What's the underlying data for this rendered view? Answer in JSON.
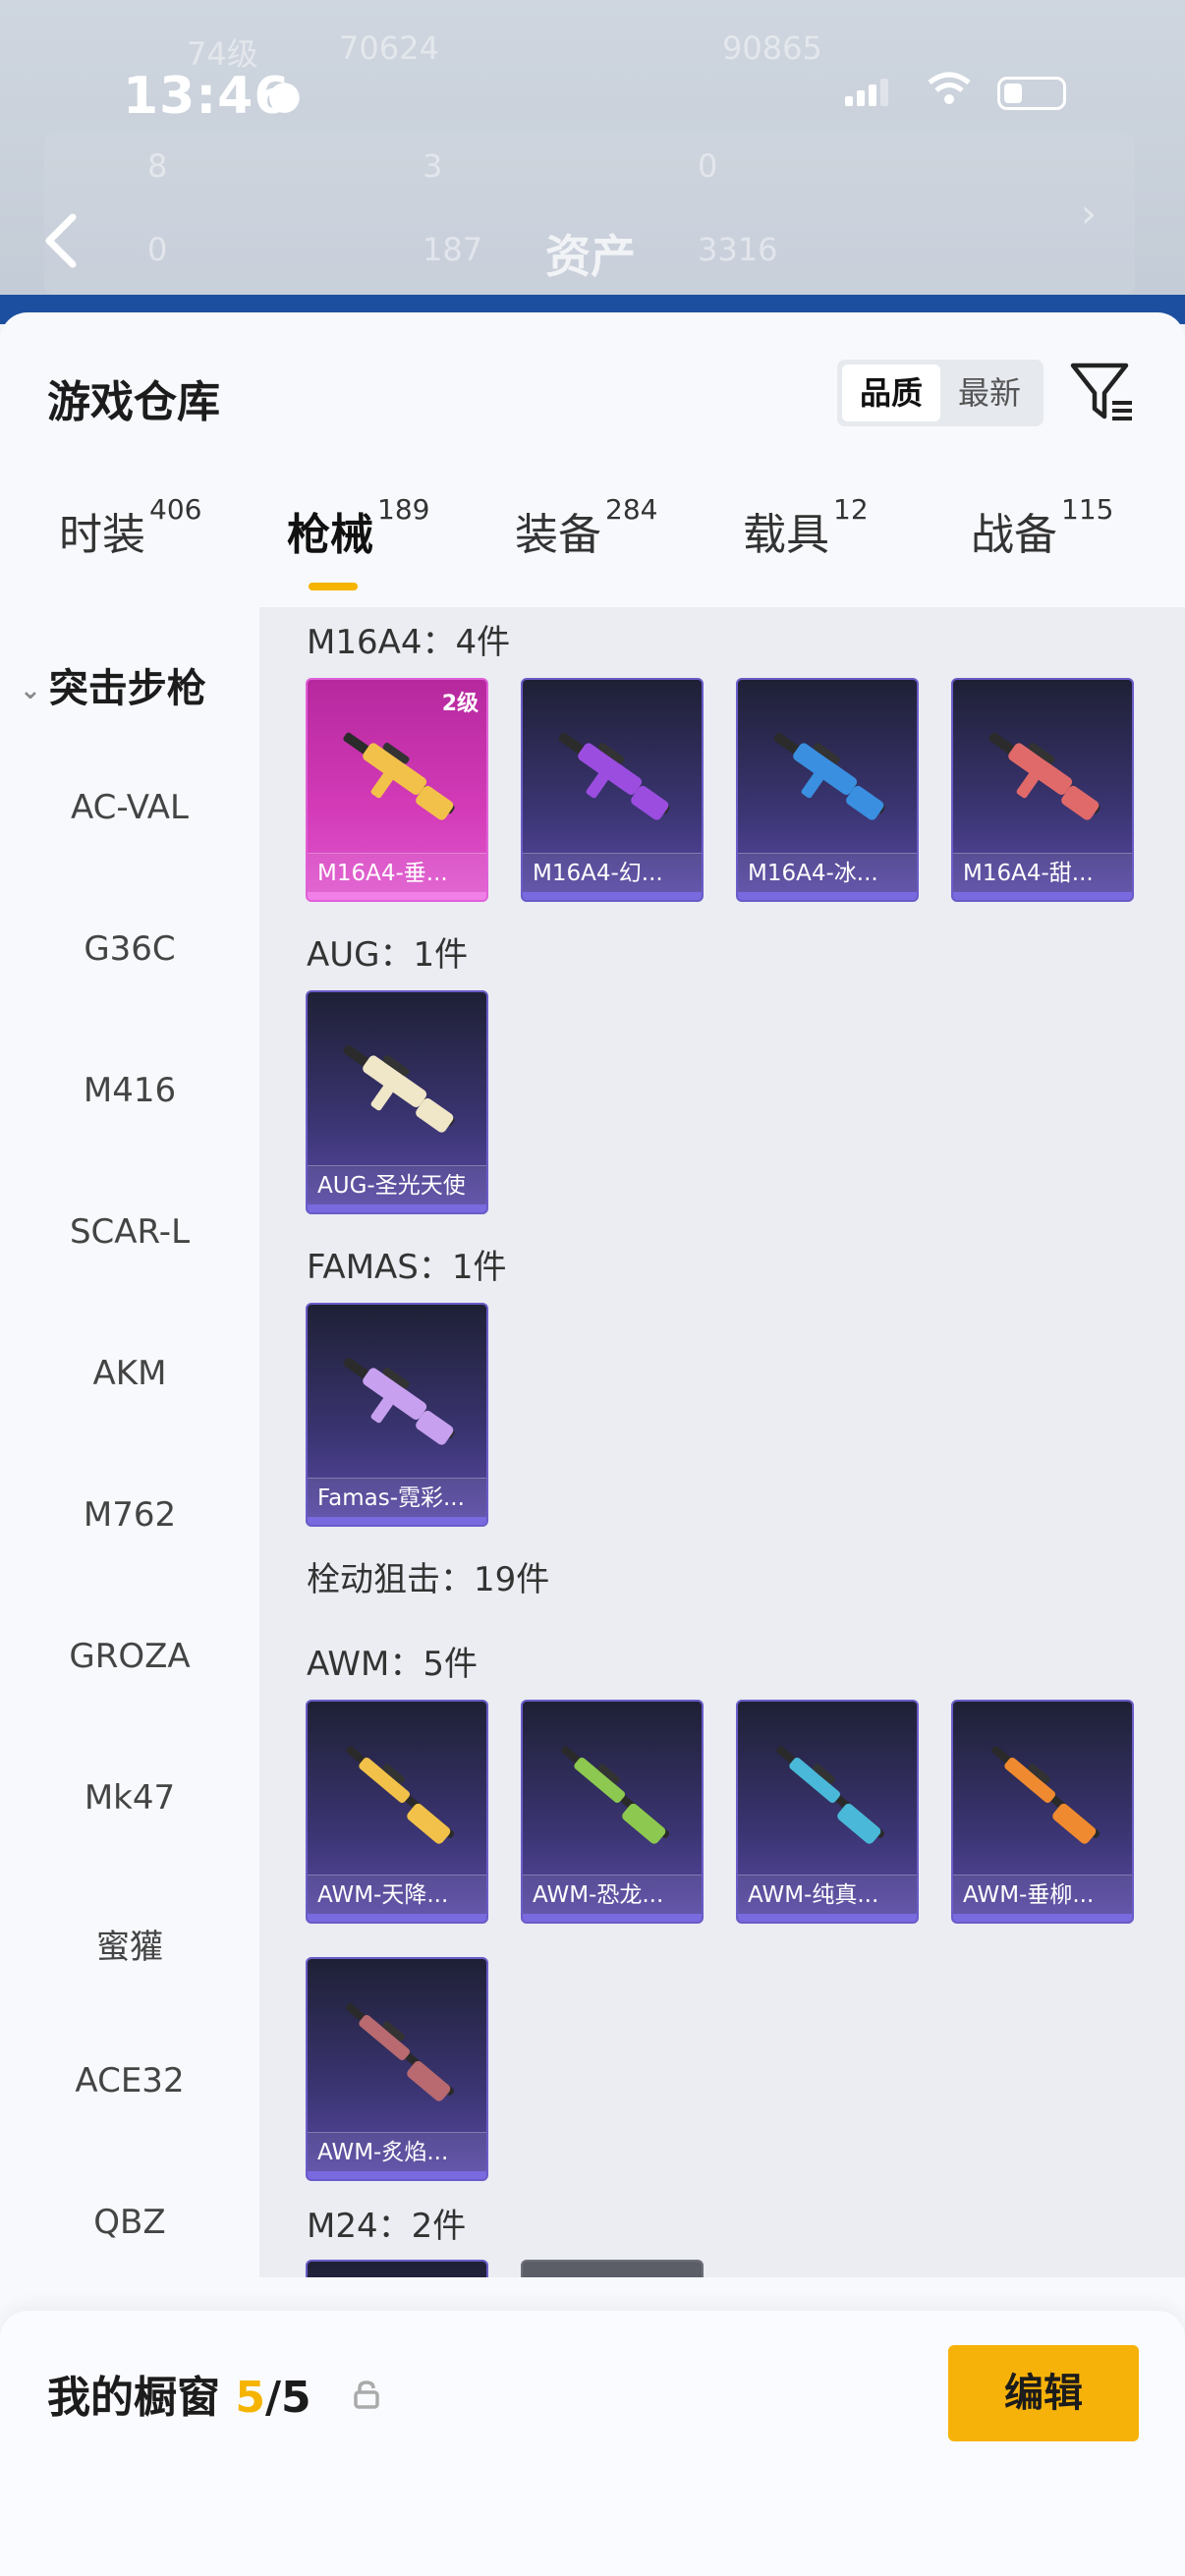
{
  "status_bar": {
    "time": "13:46"
  },
  "background_header": {
    "title": "资产",
    "ghost_texts": [
      "74级",
      "70624",
      "90865",
      "8",
      "3",
      "0",
      "0",
      "187",
      "3316"
    ]
  },
  "warehouse": {
    "title": "游戏仓库",
    "sort_options": [
      "品质",
      "最新"
    ],
    "sort_selected": "品质",
    "tabs": [
      {
        "label": "时装",
        "count": "406"
      },
      {
        "label": "枪械",
        "count": "189"
      },
      {
        "label": "装备",
        "count": "284"
      },
      {
        "label": "载具",
        "count": "12"
      },
      {
        "label": "战备",
        "count": "115"
      }
    ],
    "active_tab": "枪械"
  },
  "sidebar": {
    "category": "突击步枪",
    "items": [
      "AC-VAL",
      "G36C",
      "M416",
      "SCAR-L",
      "AKM",
      "M762",
      "GROZA",
      "Mk47",
      "蜜獾",
      "ACE32",
      "QBZ"
    ]
  },
  "sections": [
    {
      "title": "M16A4：4件",
      "cards": [
        {
          "name": "M16A4-垂...",
          "level": "2级",
          "rarity": "pink",
          "gun_color": "#f2c14a"
        },
        {
          "name": "M16A4-幻...",
          "rarity": "purple",
          "gun_color": "#9b4de0"
        },
        {
          "name": "M16A4-冰...",
          "rarity": "purple",
          "gun_color": "#3a8fe0"
        },
        {
          "name": "M16A4-甜...",
          "rarity": "purple",
          "gun_color": "#e06a6a"
        }
      ]
    },
    {
      "title": "AUG：1件",
      "cards": [
        {
          "name": "AUG-圣光天使",
          "rarity": "purple",
          "gun_color": "#f0e6c8"
        }
      ]
    },
    {
      "title": "FAMAS：1件",
      "cards": [
        {
          "name": "Famas-霓彩...",
          "rarity": "purple",
          "gun_color": "#c7a0f0"
        }
      ]
    },
    {
      "title": "栓动狙击：19件",
      "cards": []
    },
    {
      "title": "AWM：5件",
      "cards": [
        {
          "name": "AWM-天降...",
          "rarity": "purple",
          "gun_color": "#f2c14a"
        },
        {
          "name": "AWM-恐龙...",
          "rarity": "purple",
          "gun_color": "#8dc850"
        },
        {
          "name": "AWM-纯真...",
          "rarity": "purple",
          "gun_color": "#4ab8d8"
        },
        {
          "name": "AWM-垂柳...",
          "rarity": "purple",
          "gun_color": "#f08a30"
        },
        {
          "name": "AWM-炙焰...",
          "rarity": "purple",
          "gun_color": "#b86a70"
        }
      ]
    },
    {
      "title": "M24：2件",
      "cards": [
        {
          "name": "",
          "rarity": "purple",
          "gun_color": ""
        },
        {
          "name": "",
          "rarity": "grey",
          "gun_color": ""
        }
      ]
    }
  ],
  "bottom_bar": {
    "label": "我的橱窗",
    "count": "5",
    "total": "/5",
    "edit_label": "编辑"
  },
  "colors": {
    "accent": "#f5b400",
    "purple_card": "#3b3573",
    "pink_card": "#d43bb8"
  }
}
